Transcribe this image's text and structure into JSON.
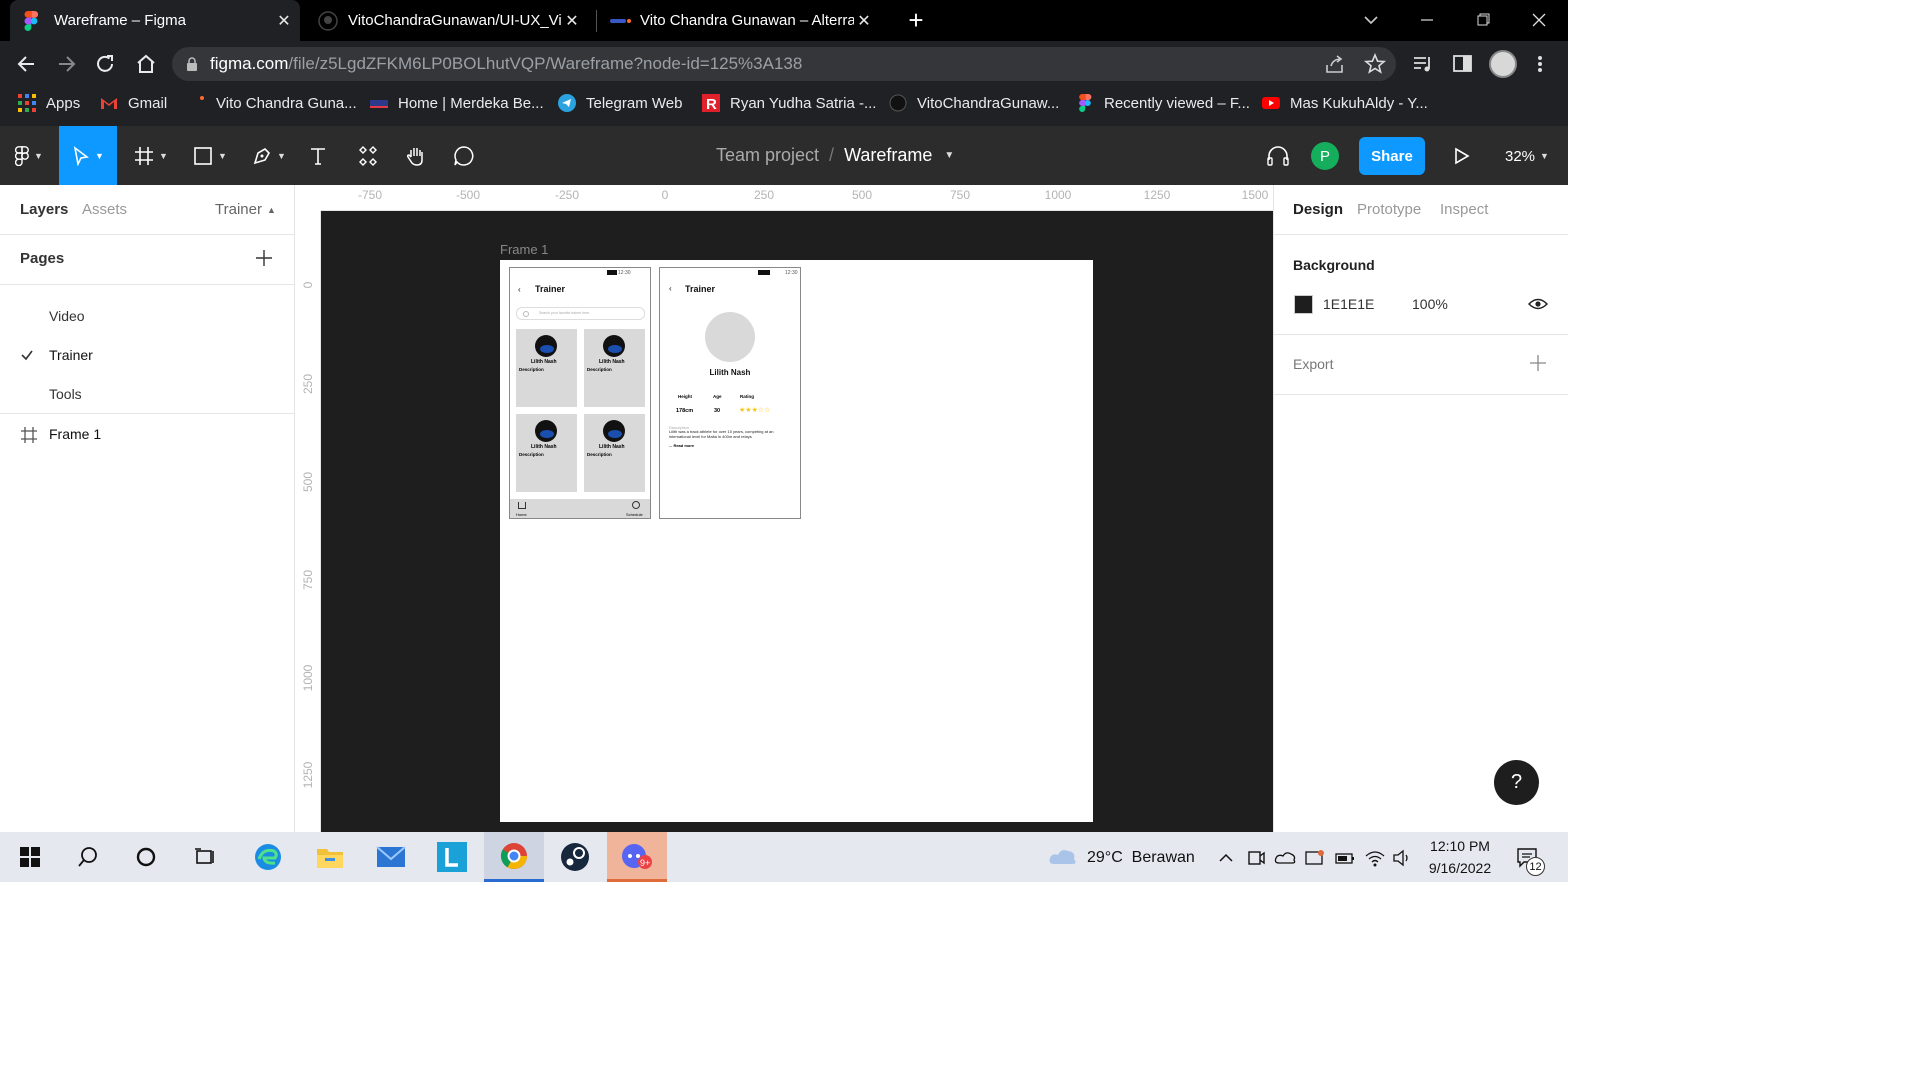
{
  "browser": {
    "tabs": [
      {
        "title": "Wareframe – Figma",
        "active": true
      },
      {
        "title": "VitoChandraGunawan/UI-UX_Vito",
        "active": false
      },
      {
        "title": "Vito Chandra Gunawan – Alterra",
        "active": false
      }
    ],
    "url_host": "figma.com",
    "url_path": "/file/z5LgdZFKM6LP0BOLhutVQP/Wareframe?node-id=125%3A138",
    "bookmarks": [
      {
        "label": "Apps",
        "icon": "apps-grid-icon"
      },
      {
        "label": "Gmail",
        "icon": "gmail-icon"
      },
      {
        "label": "Vito Chandra Guna...",
        "icon": "alterra-icon"
      },
      {
        "label": "Home | Merdeka Be...",
        "icon": "merdeka-icon"
      },
      {
        "label": "Telegram Web",
        "icon": "telegram-icon"
      },
      {
        "label": "Ryan Yudha Satria -...",
        "icon": "r-icon"
      },
      {
        "label": "VitoChandraGunaw...",
        "icon": "github-icon"
      },
      {
        "label": "Recently viewed – F...",
        "icon": "figma-icon"
      },
      {
        "label": "Mas KukuhAldy - Y...",
        "icon": "youtube-icon"
      }
    ]
  },
  "figma": {
    "breadcrumb_project": "Team project",
    "breadcrumb_sep": "/",
    "file_name": "Wareframe",
    "avatar_initial": "P",
    "share_label": "Share",
    "zoom": "32%",
    "left_panel": {
      "tab_layers": "Layers",
      "tab_assets": "Assets",
      "current_page": "Trainer",
      "pages_title": "Pages",
      "pages": [
        "Video",
        "Trainer",
        "Tools"
      ],
      "layer": "Frame 1"
    },
    "right_panel": {
      "tab_design": "Design",
      "tab_prototype": "Prototype",
      "tab_inspect": "Inspect",
      "background_title": "Background",
      "bg_color": "1E1E1E",
      "bg_opacity": "100%",
      "export_title": "Export",
      "help": "?"
    },
    "rulers": {
      "h": [
        "-750",
        "-500",
        "-250",
        "0",
        "250",
        "500",
        "750",
        "1000",
        "1250",
        "1500"
      ],
      "v": [
        "0",
        "250",
        "500",
        "750",
        "1000",
        "1250"
      ]
    },
    "canvas": {
      "frame_label": "Frame 1",
      "screen1": {
        "title": "Trainer",
        "time": "12:30",
        "search_placeholder": "Search your favorite trainer here",
        "card_name": "Lilith Nash",
        "card_desc": "Description",
        "nav_home": "Home",
        "nav_schedule": "Schedule"
      },
      "screen2": {
        "title": "Trainer",
        "time": "12:30",
        "name": "Lilith Nash",
        "height_label": "Height",
        "age_label": "Age",
        "rating_label": "Rating",
        "height_value": "178cm",
        "age_value": "30",
        "rating": 3,
        "rating_max": 5,
        "desc_label": "Description",
        "desc_text": "Lilith was a track athlete for over 10 years, competing at an international level for Malta in 400m and relays",
        "read_more": "... Read more"
      }
    }
  },
  "taskbar": {
    "weather": "29°C  Berawan",
    "time": "12:10 PM",
    "date": "9/16/2022",
    "notifications": "12"
  },
  "colors": {
    "figma_blue": "#0d99ff",
    "avatar_green": "#14ae5c",
    "canvas_bg": "#1e1e1e"
  }
}
